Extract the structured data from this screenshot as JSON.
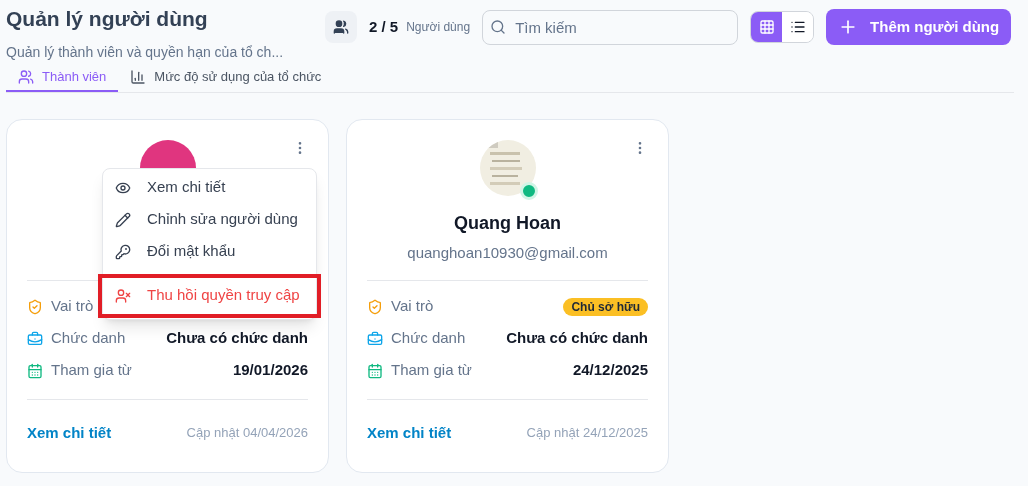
{
  "header": {
    "title": "Quản lý người dùng",
    "subtitle": "Quản lý thành viên và quyền hạn của tổ ch...",
    "count": "2 / 5",
    "count_label": "Người dùng",
    "search": {
      "placeholder": "Tìm kiếm"
    },
    "views": [
      {
        "kind": "grid",
        "selected": true
      },
      {
        "kind": "list",
        "selected": false
      }
    ],
    "add_button": "Thêm người dùng"
  },
  "tabs": [
    {
      "label": "Thành viên",
      "kind": "members",
      "selected": true
    },
    {
      "label": "Mức độ sử dụng của tổ chức",
      "kind": "usage",
      "selected": false
    }
  ],
  "cards": [
    {
      "avatar": {
        "kind": "letter"
      },
      "menu": {
        "items": [
          {
            "label": "Xem chi tiết",
            "kind": "view",
            "highlighted": false
          },
          {
            "label": "Chỉnh sửa người dùng",
            "kind": "edit",
            "highlighted": false
          },
          {
            "label": "Đổi mật khẩu",
            "kind": "password",
            "highlighted": false
          },
          {
            "label": "Thu hồi quyền truy cập",
            "kind": "revoke",
            "highlighted": true
          }
        ]
      },
      "rows": [
        {
          "kind": "role",
          "label": "Vai trò"
        },
        {
          "kind": "title",
          "label": "Chức danh",
          "value": "Chưa có chức danh"
        },
        {
          "kind": "joined",
          "label": "Tham gia từ",
          "value": "19/01/2026"
        }
      ],
      "link": "Xem chi tiết",
      "updated": "Cập nhật 04/04/2026"
    },
    {
      "avatar": {
        "kind": "picture",
        "online": true
      },
      "name": "Quang Hoan",
      "email": "quanghoan10930@gmail.com",
      "rows": [
        {
          "kind": "role",
          "label": "Vai trò",
          "badge": "Chủ sở hữu"
        },
        {
          "kind": "title",
          "label": "Chức danh",
          "value": "Chưa có chức danh"
        },
        {
          "kind": "joined",
          "label": "Tham gia từ",
          "value": "24/12/2025"
        }
      ],
      "link": "Xem chi tiết",
      "updated": "Cập nhật 24/12/2025"
    }
  ]
}
